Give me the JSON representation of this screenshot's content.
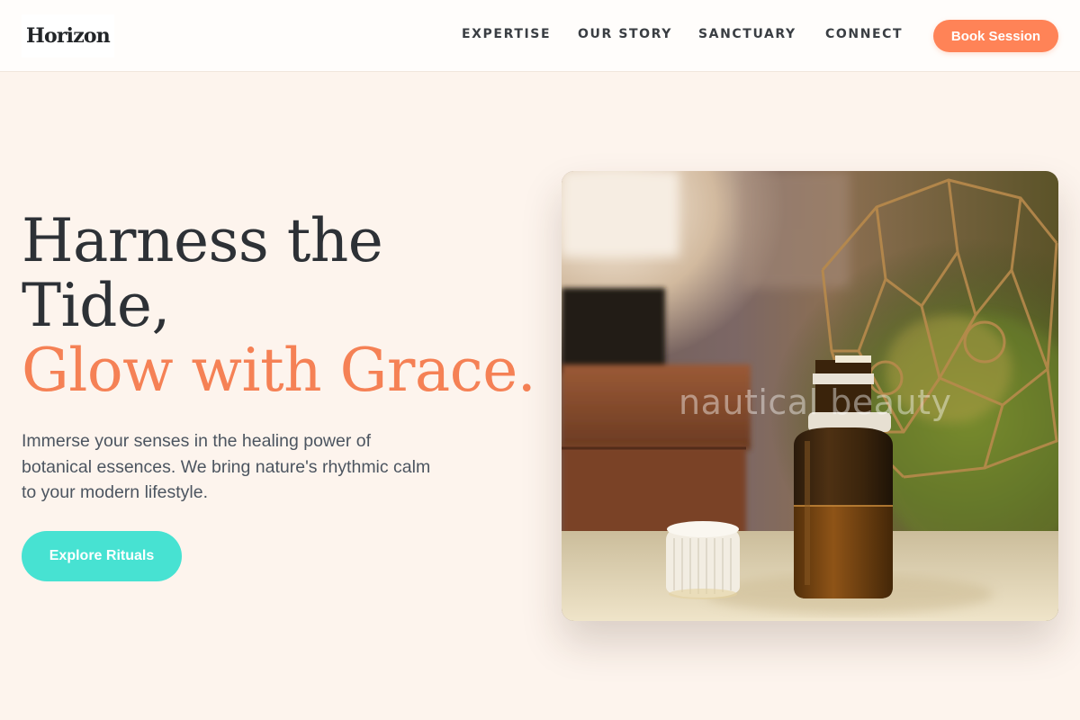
{
  "header": {
    "logo_text": "Horizon",
    "nav": [
      {
        "label": "EXPERTISE"
      },
      {
        "label": "OUR STORY"
      },
      {
        "label": "SANCTUARY"
      },
      {
        "label": "CONNECT"
      }
    ],
    "cta_label": "Book Session"
  },
  "hero": {
    "title_line1": "Harness the",
    "title_line2": "Tide,",
    "title_accent": "Glow with Grace.",
    "description": "Immerse your senses in the healing power of botanical essences. We bring nature's rhythmic calm to your modern lifestyle.",
    "button_label": "Explore Rituals",
    "image_watermark": "nautical beauty"
  },
  "colors": {
    "background": "#fdf4ed",
    "accent": "#f58155",
    "cta": "#ff8357",
    "teal": "#47e2d2",
    "heading": "#2d3136"
  }
}
